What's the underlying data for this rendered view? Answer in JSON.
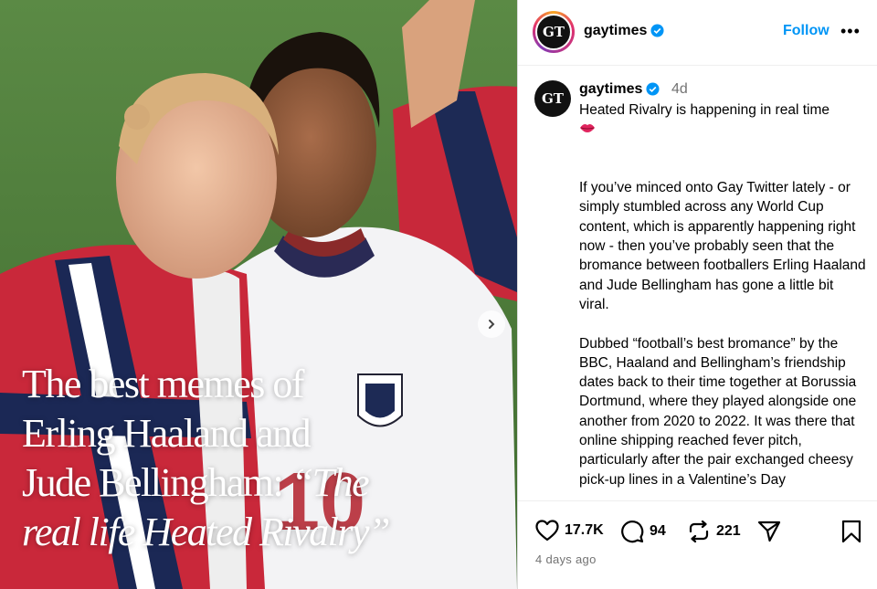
{
  "media": {
    "caption_line1": "The best memes of",
    "caption_line2": "Erling Haaland and",
    "caption_line3": "Jude Bellingham: ",
    "caption_italic3": "“The",
    "caption_italic4": "real life Heated Rivalry”",
    "next_icon": "chevron-right-icon"
  },
  "header": {
    "avatar_text": "GT",
    "username": "gaytimes",
    "follow_label": "Follow",
    "more_label": "•••"
  },
  "caption": {
    "avatar_text": "GT",
    "username": "gaytimes",
    "age": "4d",
    "body": "Heated Rivalry is happening in real time\n\n\n\nIf you’ve minced onto Gay Twitter lately - or simply stumbled across any World Cup content, which is apparently happening right now - then you’ve probably seen that the bromance between footballers Erling Haaland and Jude Bellingham has gone a little bit viral.\n\nDubbed “football’s best bromance” by the BBC, Haaland and Bellingham’s friendship dates back to their time together at Borussia Dortmund, where they played alongside one another from 2020 to 2022. It was there that online shipping reached fever pitch, particularly after the pair exchanged cheesy pick-up lines in a Valentine’s Day"
  },
  "actions": {
    "likes": "17.7K",
    "comments": "94",
    "reposts": "221",
    "date": "4 days ago"
  },
  "colors": {
    "accent": "#0095f6",
    "muted": "#737373",
    "verified": "#0095f6"
  }
}
